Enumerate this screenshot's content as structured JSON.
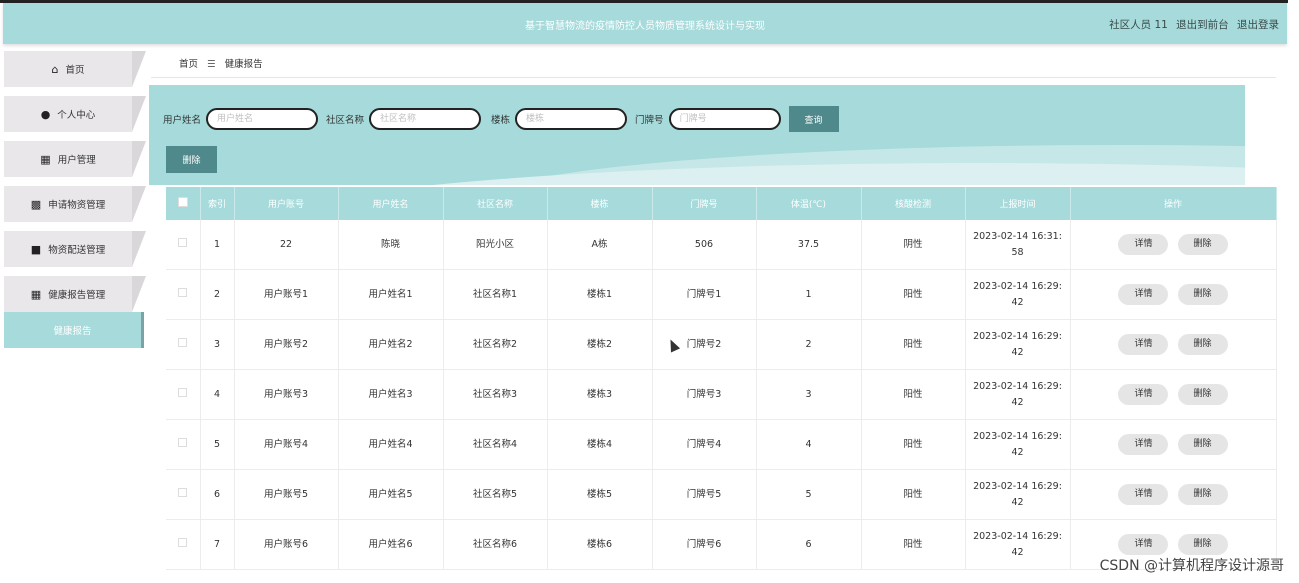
{
  "header": {
    "title": "基于智慧物流的疫情防控人员物质管理系统设计与实现",
    "user": "社区人员 11",
    "back_front": "退出到前台",
    "logout": "退出登录"
  },
  "sidebar": {
    "items": [
      {
        "label": "首页",
        "icon": "home-icon"
      },
      {
        "label": "个人中心",
        "icon": "user-icon"
      },
      {
        "label": "用户管理",
        "icon": "grid-icon"
      },
      {
        "label": "申请物资管理",
        "icon": "apps-icon"
      },
      {
        "label": "物资配送管理",
        "icon": "briefcase-icon"
      },
      {
        "label": "健康报告管理",
        "icon": "grid-icon"
      }
    ],
    "sub_item": "健康报告"
  },
  "breadcrumb": {
    "home": "首页",
    "sep": "☰",
    "current": "健康报告"
  },
  "search": {
    "username_label": "用户姓名",
    "username_placeholder": "用户姓名",
    "community_label": "社区名称",
    "community_placeholder": "社区名称",
    "building_label": "楼栋",
    "building_placeholder": "楼栋",
    "door_label": "门牌号",
    "door_placeholder": "门牌号",
    "query_button": "查询"
  },
  "toolbar": {
    "delete_button": "删除"
  },
  "table": {
    "headers": [
      "索引",
      "用户账号",
      "用户姓名",
      "社区名称",
      "楼栋",
      "门牌号",
      "体温(℃)",
      "核酸检测",
      "上报时间",
      "操作"
    ],
    "detail_label": "详情",
    "delete_label": "删除",
    "rows": [
      {
        "index": "1",
        "account": "22",
        "name": "陈晓",
        "community": "阳光小区",
        "building": "A栋",
        "door": "506",
        "temp": "37.5",
        "test": "阴性",
        "time": "2023-02-14 16:31:58"
      },
      {
        "index": "2",
        "account": "用户账号1",
        "name": "用户姓名1",
        "community": "社区名称1",
        "building": "楼栋1",
        "door": "门牌号1",
        "temp": "1",
        "test": "阳性",
        "time": "2023-02-14 16:29:42"
      },
      {
        "index": "3",
        "account": "用户账号2",
        "name": "用户姓名2",
        "community": "社区名称2",
        "building": "楼栋2",
        "door": "门牌号2",
        "temp": "2",
        "test": "阳性",
        "time": "2023-02-14 16:29:42"
      },
      {
        "index": "4",
        "account": "用户账号3",
        "name": "用户姓名3",
        "community": "社区名称3",
        "building": "楼栋3",
        "door": "门牌号3",
        "temp": "3",
        "test": "阳性",
        "time": "2023-02-14 16:29:42"
      },
      {
        "index": "5",
        "account": "用户账号4",
        "name": "用户姓名4",
        "community": "社区名称4",
        "building": "楼栋4",
        "door": "门牌号4",
        "temp": "4",
        "test": "阳性",
        "time": "2023-02-14 16:29:42"
      },
      {
        "index": "6",
        "account": "用户账号5",
        "name": "用户姓名5",
        "community": "社区名称5",
        "building": "楼栋5",
        "door": "门牌号5",
        "temp": "5",
        "test": "阳性",
        "time": "2023-02-14 16:29:42"
      },
      {
        "index": "7",
        "account": "用户账号6",
        "name": "用户姓名6",
        "community": "社区名称6",
        "building": "楼栋6",
        "door": "门牌号6",
        "temp": "6",
        "test": "阳性",
        "time": "2023-02-14 16:29:42"
      }
    ]
  },
  "watermark": "CSDN @计算机程序设计源哥",
  "colors": {
    "accent": "#a6dadb",
    "button": "#4f898b"
  }
}
